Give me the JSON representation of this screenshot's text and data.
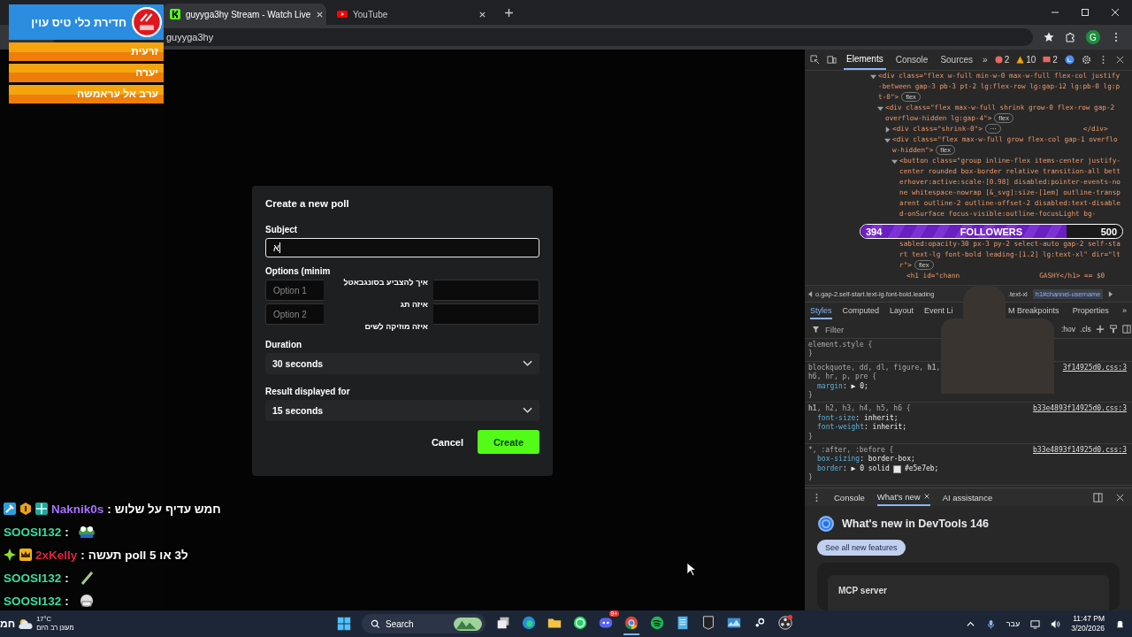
{
  "browser": {
    "tabs": [
      {
        "title": "guyyga3hy Stream - Watch Live",
        "selected": true,
        "kind": "kick"
      },
      {
        "title": "YouTube",
        "selected": false,
        "kind": "youtube"
      }
    ],
    "address": "guyyga3hy",
    "profile": "G"
  },
  "modal": {
    "title": "Create a new poll",
    "subject_label": "Subject",
    "subject_value": "א",
    "options_label": "Options (minim",
    "options": [
      {
        "placeholder": "Option 1"
      },
      {
        "placeholder": "Option 2"
      }
    ],
    "suggestions": [
      "איך להצביע בסונגבאטל",
      "איזה תג",
      "איזה מוזיקה לשים"
    ],
    "duration_label": "Duration",
    "duration": "30 seconds",
    "result_label": "Result displayed for",
    "result": "15 seconds",
    "cancel": "Cancel",
    "create": "Create"
  },
  "devtools": {
    "tabs": [
      {
        "label": "Elements",
        "selected": true
      },
      {
        "label": "Console",
        "selected": false
      },
      {
        "label": "Sources",
        "selected": false
      }
    ],
    "more": "»",
    "errors": "2",
    "warnings": "10",
    "issues": "2",
    "nodes": [
      {
        "text": "<div class=\"flex w-full min-w-0 max-w-full flex-col justify-between gap-3 pb-3 pt-2 lg:flex-row lg:gap-12 lg:pb-0 lg:pt-0\">",
        "badge": "flex",
        "expanded": true,
        "children": [
          {
            "text": "<div class=\"flex max-w-full shrink grow-0 flex-row gap-2 overflow-hidden lg:gap-4\">",
            "badge": "flex",
            "expanded": true,
            "children": [
              {
                "text": "<div class=\"shrink-0\">",
                "badge": "⋯",
                "closing": "</div>",
                "expanded": false
              },
              {
                "text": "<div class=\"flex max-w-full grow flex-col gap-1 overflow-hidden\">",
                "badge": "flex",
                "expanded": true,
                "children": [
                  {
                    "text": "<button class=\"group inline-flex items-center justify-center rounded box-border relative transition-all betterhover:active:scale-[0.98] disabled:pointer-events-none whitespace-nowrap [&_svg]:size-[1em] outline-transparent outline-2 outline-offset-2 disabled:text-disabled-onSurface focus-visible:outline-focusLight bg-",
                    "text_after": "sabled:opacity-30 px-3 py-2 select-auto gap-2 self-start text-lg font-bold leading-[1.2] lg:text-xl\" dir=\"ltr\">",
                    "badge": "flex",
                    "expanded": true,
                    "children": [
                      {
                        "text": "<h1 id=\"chann",
                        "closing": "GASHY</h1> == $0"
                      }
                    ]
                  }
                ]
              }
            ]
          }
        ]
      }
    ],
    "breadcrumb_left": "o.gap-2.self-start.text-lg.font-bold.leading",
    "breadcrumb_right": [
      {
        "text": ".text-xl",
        "selected": false
      },
      {
        "text": "h1#channel-username",
        "selected": true
      }
    ],
    "style_tabs_left": [
      {
        "label": "Styles",
        "selected": true
      },
      {
        "label": "Computed",
        "selected": false
      },
      {
        "label": "Layout",
        "selected": false
      },
      {
        "label": "Event Li",
        "selected": false
      }
    ],
    "style_tabs_right": [
      {
        "label": "M Breakpoints",
        "selected": false
      },
      {
        "label": "Properties",
        "selected": false
      }
    ],
    "style_tabs_more": "»",
    "filter_placeholder": "Filter",
    "hov": ":hov",
    "cls": ".cls",
    "rules": [
      {
        "selector": "element.style {",
        "close": "}"
      },
      {
        "selector": "blockquote, dd, dl, figure, **h1**,",
        "selector2": "h6, hr, p, pre {",
        "source": "3f14925d0.css:3",
        "close": "}",
        "props": [
          {
            "name": "margin",
            "value": ": ▶ 0;"
          }
        ]
      },
      {
        "selector": "**h1**, h2, h3, h4, h5, h6 {",
        "source": "b33e4893f14925d0.css:3",
        "close": "}",
        "props": [
          {
            "name": "font-size",
            "value": ": inherit;"
          },
          {
            "name": "font-weight",
            "value": ": inherit;"
          }
        ]
      },
      {
        "selector": "*, :after, :before {",
        "source": "b33e4893f14925d0.css:3",
        "close": "}",
        "props": [
          {
            "name": "box-sizing",
            "value": ": border-box;"
          },
          {
            "name": "border",
            "value": ": ▶ 0 solid",
            "color": "#e5e7eb",
            "value2": "#e5e7eb;"
          }
        ]
      }
    ],
    "drawer_tabs": [
      {
        "label": "Console",
        "selected": false
      },
      {
        "label": "What's new",
        "selected": true
      },
      {
        "label": "AI assistance",
        "selected": false
      }
    ],
    "whats_new": "What's new in DevTools 146",
    "see_all": "See all new features",
    "card": "MCP server"
  },
  "overlay": {
    "alert_title": "חדירת כלי טיס עוין",
    "alert_places": [
      "זרעית",
      "יערה",
      "ערב אל עראמשה"
    ],
    "followers": {
      "current": "394",
      "label": "FOLLOWERS",
      "goal": "500",
      "level": 0.788
    }
  },
  "chat": [
    {
      "user": "Naknik0s",
      "color": "#a970ff",
      "badges": [
        {
          "kind": "hammer"
        },
        {
          "kind": "one"
        },
        {
          "kind": "gift"
        }
      ],
      "message": "חמש עדיף על שלוש",
      "kind": "text",
      "sep": ":"
    },
    {
      "user": "SOOSI132",
      "color": "#36e0a0",
      "kind": "frog",
      "sep": ":"
    },
    {
      "user": "2xKelly",
      "color": "#e0243c",
      "badges": [
        {
          "kind": "star"
        },
        {
          "kind": "crown"
        }
      ],
      "message": "ל3 או 5 poll תעשה",
      "kind": "text",
      "sep": ":"
    },
    {
      "user": "SOOSI132",
      "color": "#36e0a0",
      "kind": "stick",
      "sep": ":"
    },
    {
      "user": "SOOSI132",
      "color": "#36e0a0",
      "kind": "face",
      "sep": ":"
    }
  ],
  "taskbar": {
    "weather_edge": "חמ",
    "temp": "17°C",
    "forecast": "מעונן רב היום",
    "search": "Search",
    "discord_badge": "9+",
    "language": "עבר",
    "time": "11:47 PM",
    "date": "3/20/2026",
    "apps": [
      {
        "kind": "taskview",
        "selected": false
      },
      {
        "kind": "edge",
        "selected": false
      },
      {
        "kind": "folder",
        "selected": false
      },
      {
        "kind": "whatsapp",
        "selected": false
      },
      {
        "kind": "discord",
        "selected": false
      },
      {
        "kind": "chrome",
        "selected": true
      },
      {
        "kind": "spotify",
        "selected": false
      },
      {
        "kind": "notepad",
        "selected": false
      },
      {
        "kind": "epic",
        "selected": false
      },
      {
        "kind": "monitor",
        "selected": false
      },
      {
        "kind": "steam",
        "selected": false
      },
      {
        "kind": "obs",
        "selected": false
      }
    ]
  }
}
